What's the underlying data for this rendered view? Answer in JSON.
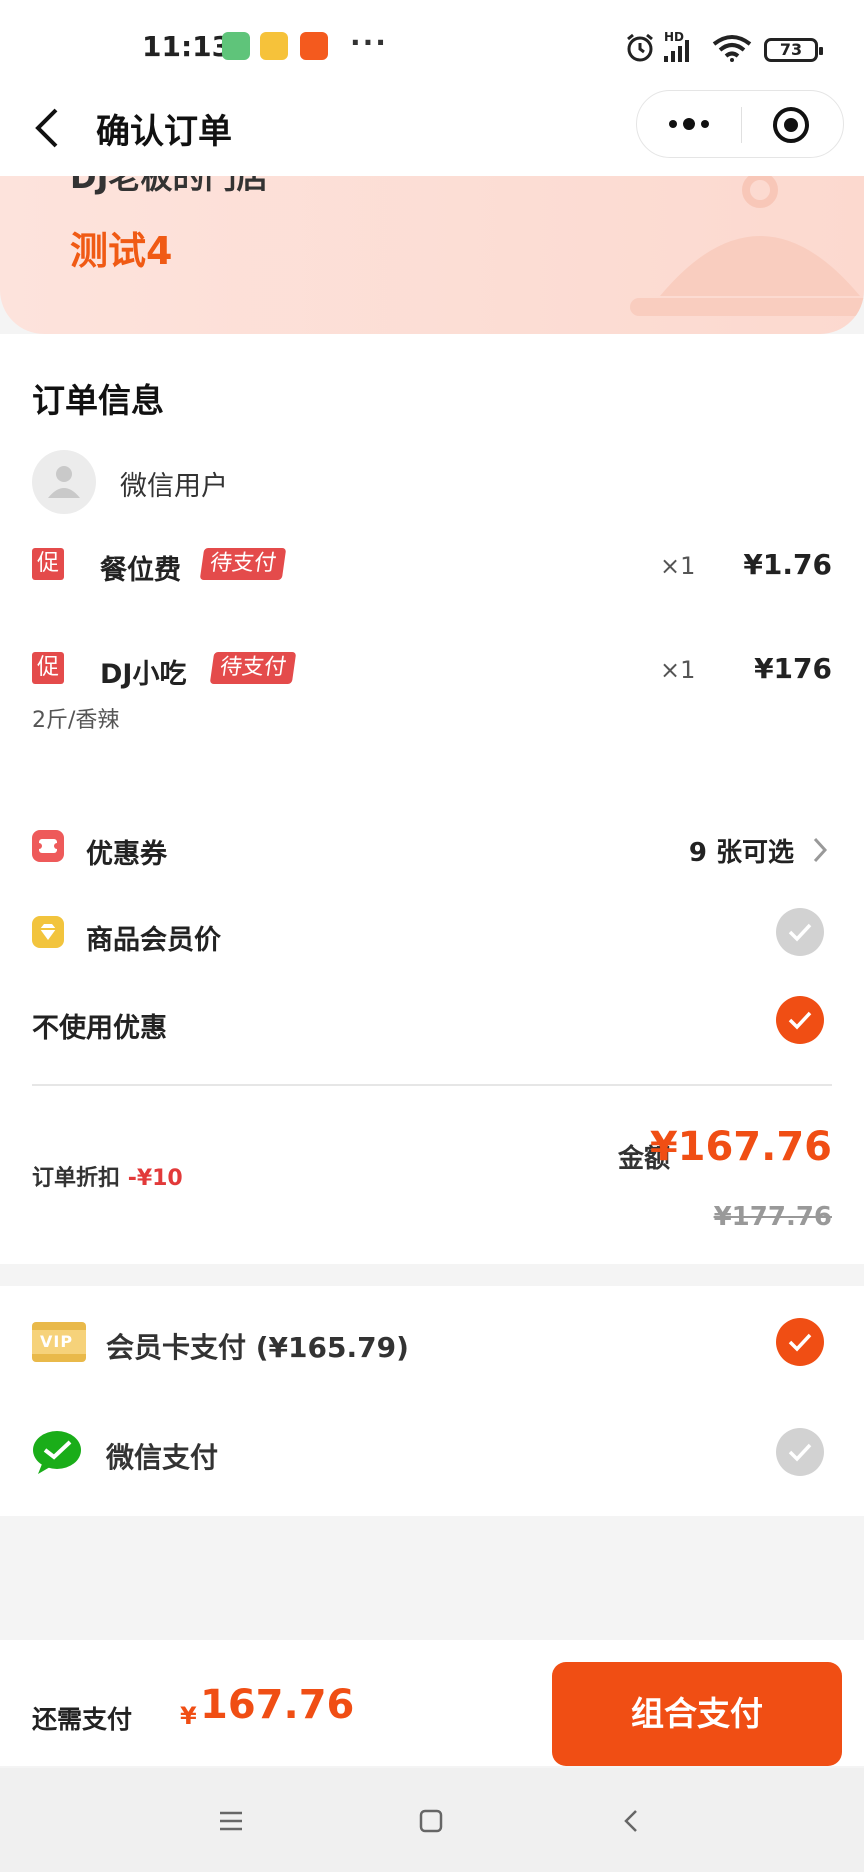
{
  "status_bar": {
    "time": "11:13",
    "more": "···",
    "network": "HD",
    "battery": "73"
  },
  "nav": {
    "title": "确认订单"
  },
  "shop": {
    "name": "DJ老板的门店",
    "table": "测试4"
  },
  "order": {
    "section_title": "订单信息",
    "username": "微信用户",
    "items": [
      {
        "promo": "促",
        "name": "餐位费",
        "tag": "待支付",
        "qty": "×1",
        "price": "¥1.76",
        "spec": ""
      },
      {
        "promo": "促",
        "name": "DJ小吃",
        "tag": "待支付",
        "qty": "×1",
        "price": "¥176",
        "spec": "2斤/香辣"
      }
    ]
  },
  "discounts": {
    "coupon": {
      "label": "优惠券",
      "value": "9 张可选"
    },
    "member_price": {
      "label": "商品会员价",
      "checked": false
    },
    "no_discount": {
      "label": "不使用优惠",
      "checked": true
    }
  },
  "summary": {
    "discount_label": "订单折扣",
    "discount_value": "-¥10",
    "amount_label": "金额",
    "amount": "¥167.76",
    "original": "¥177.76"
  },
  "payment": {
    "methods": [
      {
        "label": "会员卡支付 (¥165.79)",
        "icon": "vip-card-icon",
        "checked": true
      },
      {
        "label": "微信支付",
        "icon": "wechat-pay-icon",
        "checked": false
      }
    ]
  },
  "footer": {
    "need_label": "还需支付",
    "currency": "¥",
    "amount": "167.76",
    "button": "组合支付"
  },
  "colors": {
    "accent": "#f04e14",
    "tag_red": "#e44b4b",
    "banner": "#fde3dc"
  }
}
